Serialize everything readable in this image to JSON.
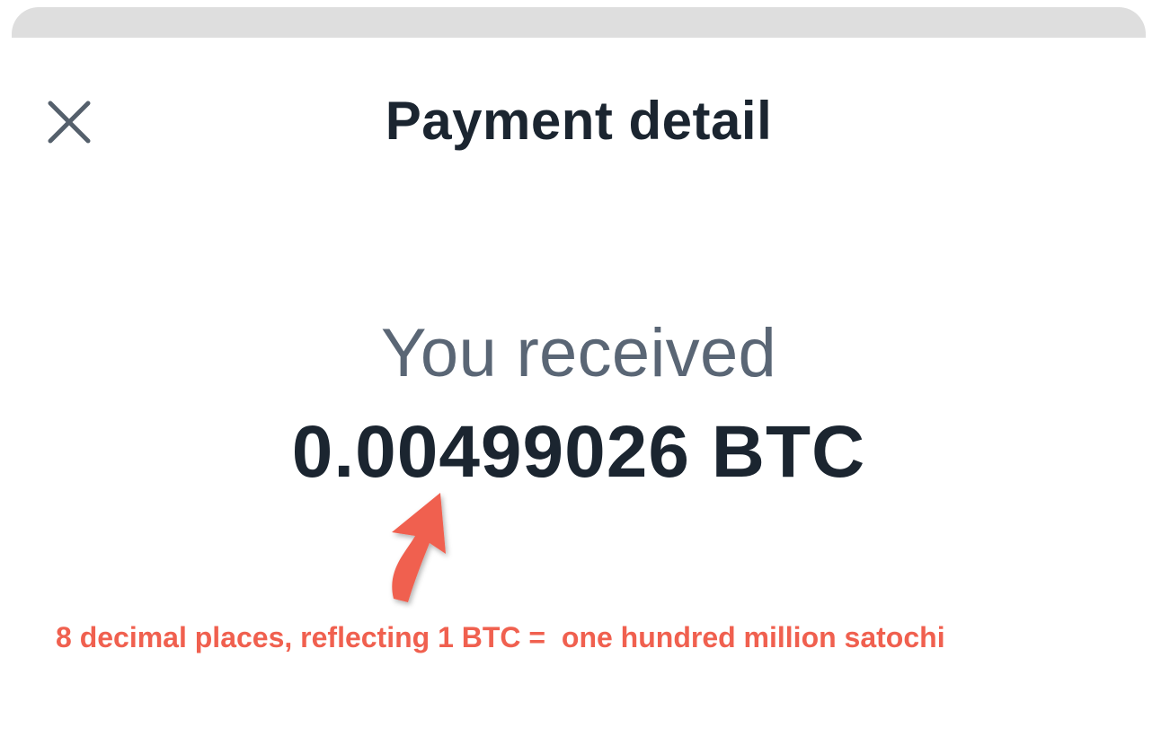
{
  "header": {
    "title": "Payment detail",
    "close_icon": "close-icon"
  },
  "payment": {
    "label": "You received",
    "amount": "0.00499026 BTC"
  },
  "annotation": {
    "text": "8 decimal places, reflecting 1 BTC =  one hundred million satochi",
    "color": "#f0604f",
    "arrow_icon": "arrow-annotation-icon"
  },
  "colors": {
    "title": "#1b2530",
    "label": "#5a6675",
    "sheet_handle": "#dedede"
  }
}
